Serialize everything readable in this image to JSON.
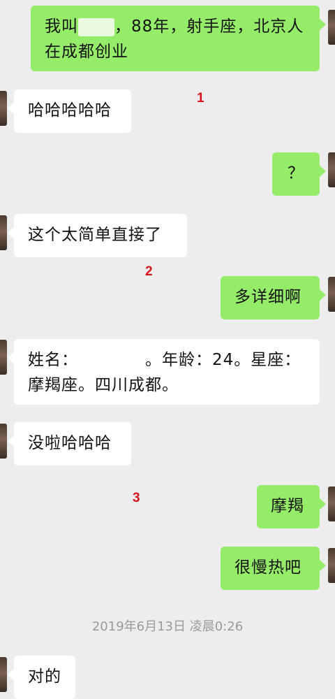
{
  "messages": [
    {
      "side": "out",
      "parts": [
        "我叫",
        "，88年，射手座，北京人在成都创业"
      ]
    },
    {
      "side": "in",
      "text": "哈哈哈哈哈"
    },
    {
      "side": "out",
      "text": "？"
    },
    {
      "side": "in",
      "text": "这个太简单直接了"
    },
    {
      "side": "out",
      "text": "多详细啊"
    },
    {
      "side": "in",
      "parts": [
        "姓名：",
        "。年龄：24。星座：摩羯座。四川成都。"
      ]
    },
    {
      "side": "in",
      "text": "没啦哈哈哈"
    },
    {
      "side": "out",
      "text": "摩羯"
    },
    {
      "side": "out",
      "text": "很慢热吧"
    },
    {
      "side": "in",
      "text": "对的"
    }
  ],
  "annotations": [
    "1",
    "2",
    "3"
  ],
  "timestamp": "2019年6月13日 凌晨0:26"
}
